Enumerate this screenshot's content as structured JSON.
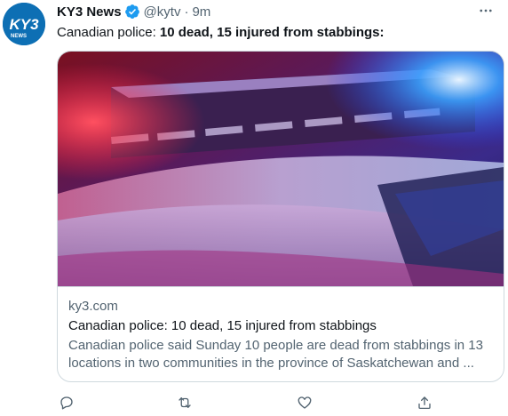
{
  "tweet": {
    "display_name": "KY3 News",
    "handle": "@kytv",
    "separator": "·",
    "time": "9m",
    "text_prefix": "Canadian police: ",
    "text_bold": "10 dead, 15 injured from stabbings:",
    "avatar_logo_text": "KY3",
    "avatar_logo_subtext": "NEWS"
  },
  "card": {
    "domain": "ky3.com",
    "title": "Canadian police: 10 dead, 15 injured from stabbings",
    "description": "Canadian police said Sunday 10 people are dead from stabbings in 13 locations in two communities in the province of Saskatchewan and ...",
    "image_icon": "police-car-lights-photo"
  },
  "actions": {
    "reply_icon": "reply-icon",
    "retweet_icon": "retweet-icon",
    "like_icon": "like-icon",
    "share_icon": "share-icon",
    "more_icon": "more-icon",
    "verified_icon": "verified-badge-icon"
  },
  "colors": {
    "verified": "#1d9bf0",
    "secondary_text": "#536471",
    "border": "#cfd9de",
    "avatar_bg": "#0d6fb4"
  }
}
